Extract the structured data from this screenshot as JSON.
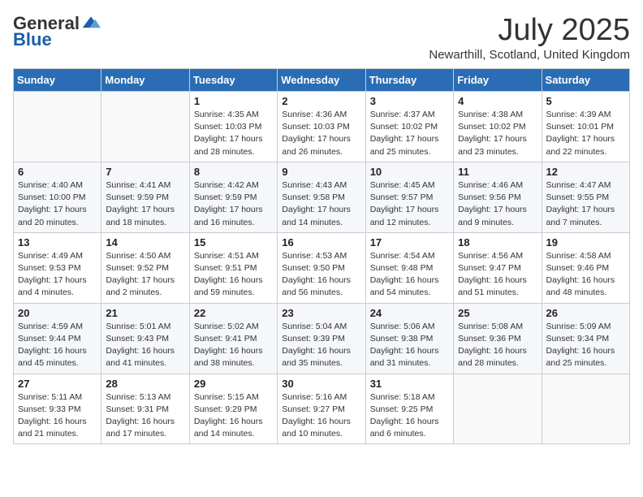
{
  "header": {
    "logo_general": "General",
    "logo_blue": "Blue",
    "month_title": "July 2025",
    "location": "Newarthill, Scotland, United Kingdom"
  },
  "weekdays": [
    "Sunday",
    "Monday",
    "Tuesday",
    "Wednesday",
    "Thursday",
    "Friday",
    "Saturday"
  ],
  "weeks": [
    [
      {
        "day": "",
        "info": ""
      },
      {
        "day": "",
        "info": ""
      },
      {
        "day": "1",
        "info": "Sunrise: 4:35 AM\nSunset: 10:03 PM\nDaylight: 17 hours and 28 minutes."
      },
      {
        "day": "2",
        "info": "Sunrise: 4:36 AM\nSunset: 10:03 PM\nDaylight: 17 hours and 26 minutes."
      },
      {
        "day": "3",
        "info": "Sunrise: 4:37 AM\nSunset: 10:02 PM\nDaylight: 17 hours and 25 minutes."
      },
      {
        "day": "4",
        "info": "Sunrise: 4:38 AM\nSunset: 10:02 PM\nDaylight: 17 hours and 23 minutes."
      },
      {
        "day": "5",
        "info": "Sunrise: 4:39 AM\nSunset: 10:01 PM\nDaylight: 17 hours and 22 minutes."
      }
    ],
    [
      {
        "day": "6",
        "info": "Sunrise: 4:40 AM\nSunset: 10:00 PM\nDaylight: 17 hours and 20 minutes."
      },
      {
        "day": "7",
        "info": "Sunrise: 4:41 AM\nSunset: 9:59 PM\nDaylight: 17 hours and 18 minutes."
      },
      {
        "day": "8",
        "info": "Sunrise: 4:42 AM\nSunset: 9:59 PM\nDaylight: 17 hours and 16 minutes."
      },
      {
        "day": "9",
        "info": "Sunrise: 4:43 AM\nSunset: 9:58 PM\nDaylight: 17 hours and 14 minutes."
      },
      {
        "day": "10",
        "info": "Sunrise: 4:45 AM\nSunset: 9:57 PM\nDaylight: 17 hours and 12 minutes."
      },
      {
        "day": "11",
        "info": "Sunrise: 4:46 AM\nSunset: 9:56 PM\nDaylight: 17 hours and 9 minutes."
      },
      {
        "day": "12",
        "info": "Sunrise: 4:47 AM\nSunset: 9:55 PM\nDaylight: 17 hours and 7 minutes."
      }
    ],
    [
      {
        "day": "13",
        "info": "Sunrise: 4:49 AM\nSunset: 9:53 PM\nDaylight: 17 hours and 4 minutes."
      },
      {
        "day": "14",
        "info": "Sunrise: 4:50 AM\nSunset: 9:52 PM\nDaylight: 17 hours and 2 minutes."
      },
      {
        "day": "15",
        "info": "Sunrise: 4:51 AM\nSunset: 9:51 PM\nDaylight: 16 hours and 59 minutes."
      },
      {
        "day": "16",
        "info": "Sunrise: 4:53 AM\nSunset: 9:50 PM\nDaylight: 16 hours and 56 minutes."
      },
      {
        "day": "17",
        "info": "Sunrise: 4:54 AM\nSunset: 9:48 PM\nDaylight: 16 hours and 54 minutes."
      },
      {
        "day": "18",
        "info": "Sunrise: 4:56 AM\nSunset: 9:47 PM\nDaylight: 16 hours and 51 minutes."
      },
      {
        "day": "19",
        "info": "Sunrise: 4:58 AM\nSunset: 9:46 PM\nDaylight: 16 hours and 48 minutes."
      }
    ],
    [
      {
        "day": "20",
        "info": "Sunrise: 4:59 AM\nSunset: 9:44 PM\nDaylight: 16 hours and 45 minutes."
      },
      {
        "day": "21",
        "info": "Sunrise: 5:01 AM\nSunset: 9:43 PM\nDaylight: 16 hours and 41 minutes."
      },
      {
        "day": "22",
        "info": "Sunrise: 5:02 AM\nSunset: 9:41 PM\nDaylight: 16 hours and 38 minutes."
      },
      {
        "day": "23",
        "info": "Sunrise: 5:04 AM\nSunset: 9:39 PM\nDaylight: 16 hours and 35 minutes."
      },
      {
        "day": "24",
        "info": "Sunrise: 5:06 AM\nSunset: 9:38 PM\nDaylight: 16 hours and 31 minutes."
      },
      {
        "day": "25",
        "info": "Sunrise: 5:08 AM\nSunset: 9:36 PM\nDaylight: 16 hours and 28 minutes."
      },
      {
        "day": "26",
        "info": "Sunrise: 5:09 AM\nSunset: 9:34 PM\nDaylight: 16 hours and 25 minutes."
      }
    ],
    [
      {
        "day": "27",
        "info": "Sunrise: 5:11 AM\nSunset: 9:33 PM\nDaylight: 16 hours and 21 minutes."
      },
      {
        "day": "28",
        "info": "Sunrise: 5:13 AM\nSunset: 9:31 PM\nDaylight: 16 hours and 17 minutes."
      },
      {
        "day": "29",
        "info": "Sunrise: 5:15 AM\nSunset: 9:29 PM\nDaylight: 16 hours and 14 minutes."
      },
      {
        "day": "30",
        "info": "Sunrise: 5:16 AM\nSunset: 9:27 PM\nDaylight: 16 hours and 10 minutes."
      },
      {
        "day": "31",
        "info": "Sunrise: 5:18 AM\nSunset: 9:25 PM\nDaylight: 16 hours and 6 minutes."
      },
      {
        "day": "",
        "info": ""
      },
      {
        "day": "",
        "info": ""
      }
    ]
  ]
}
